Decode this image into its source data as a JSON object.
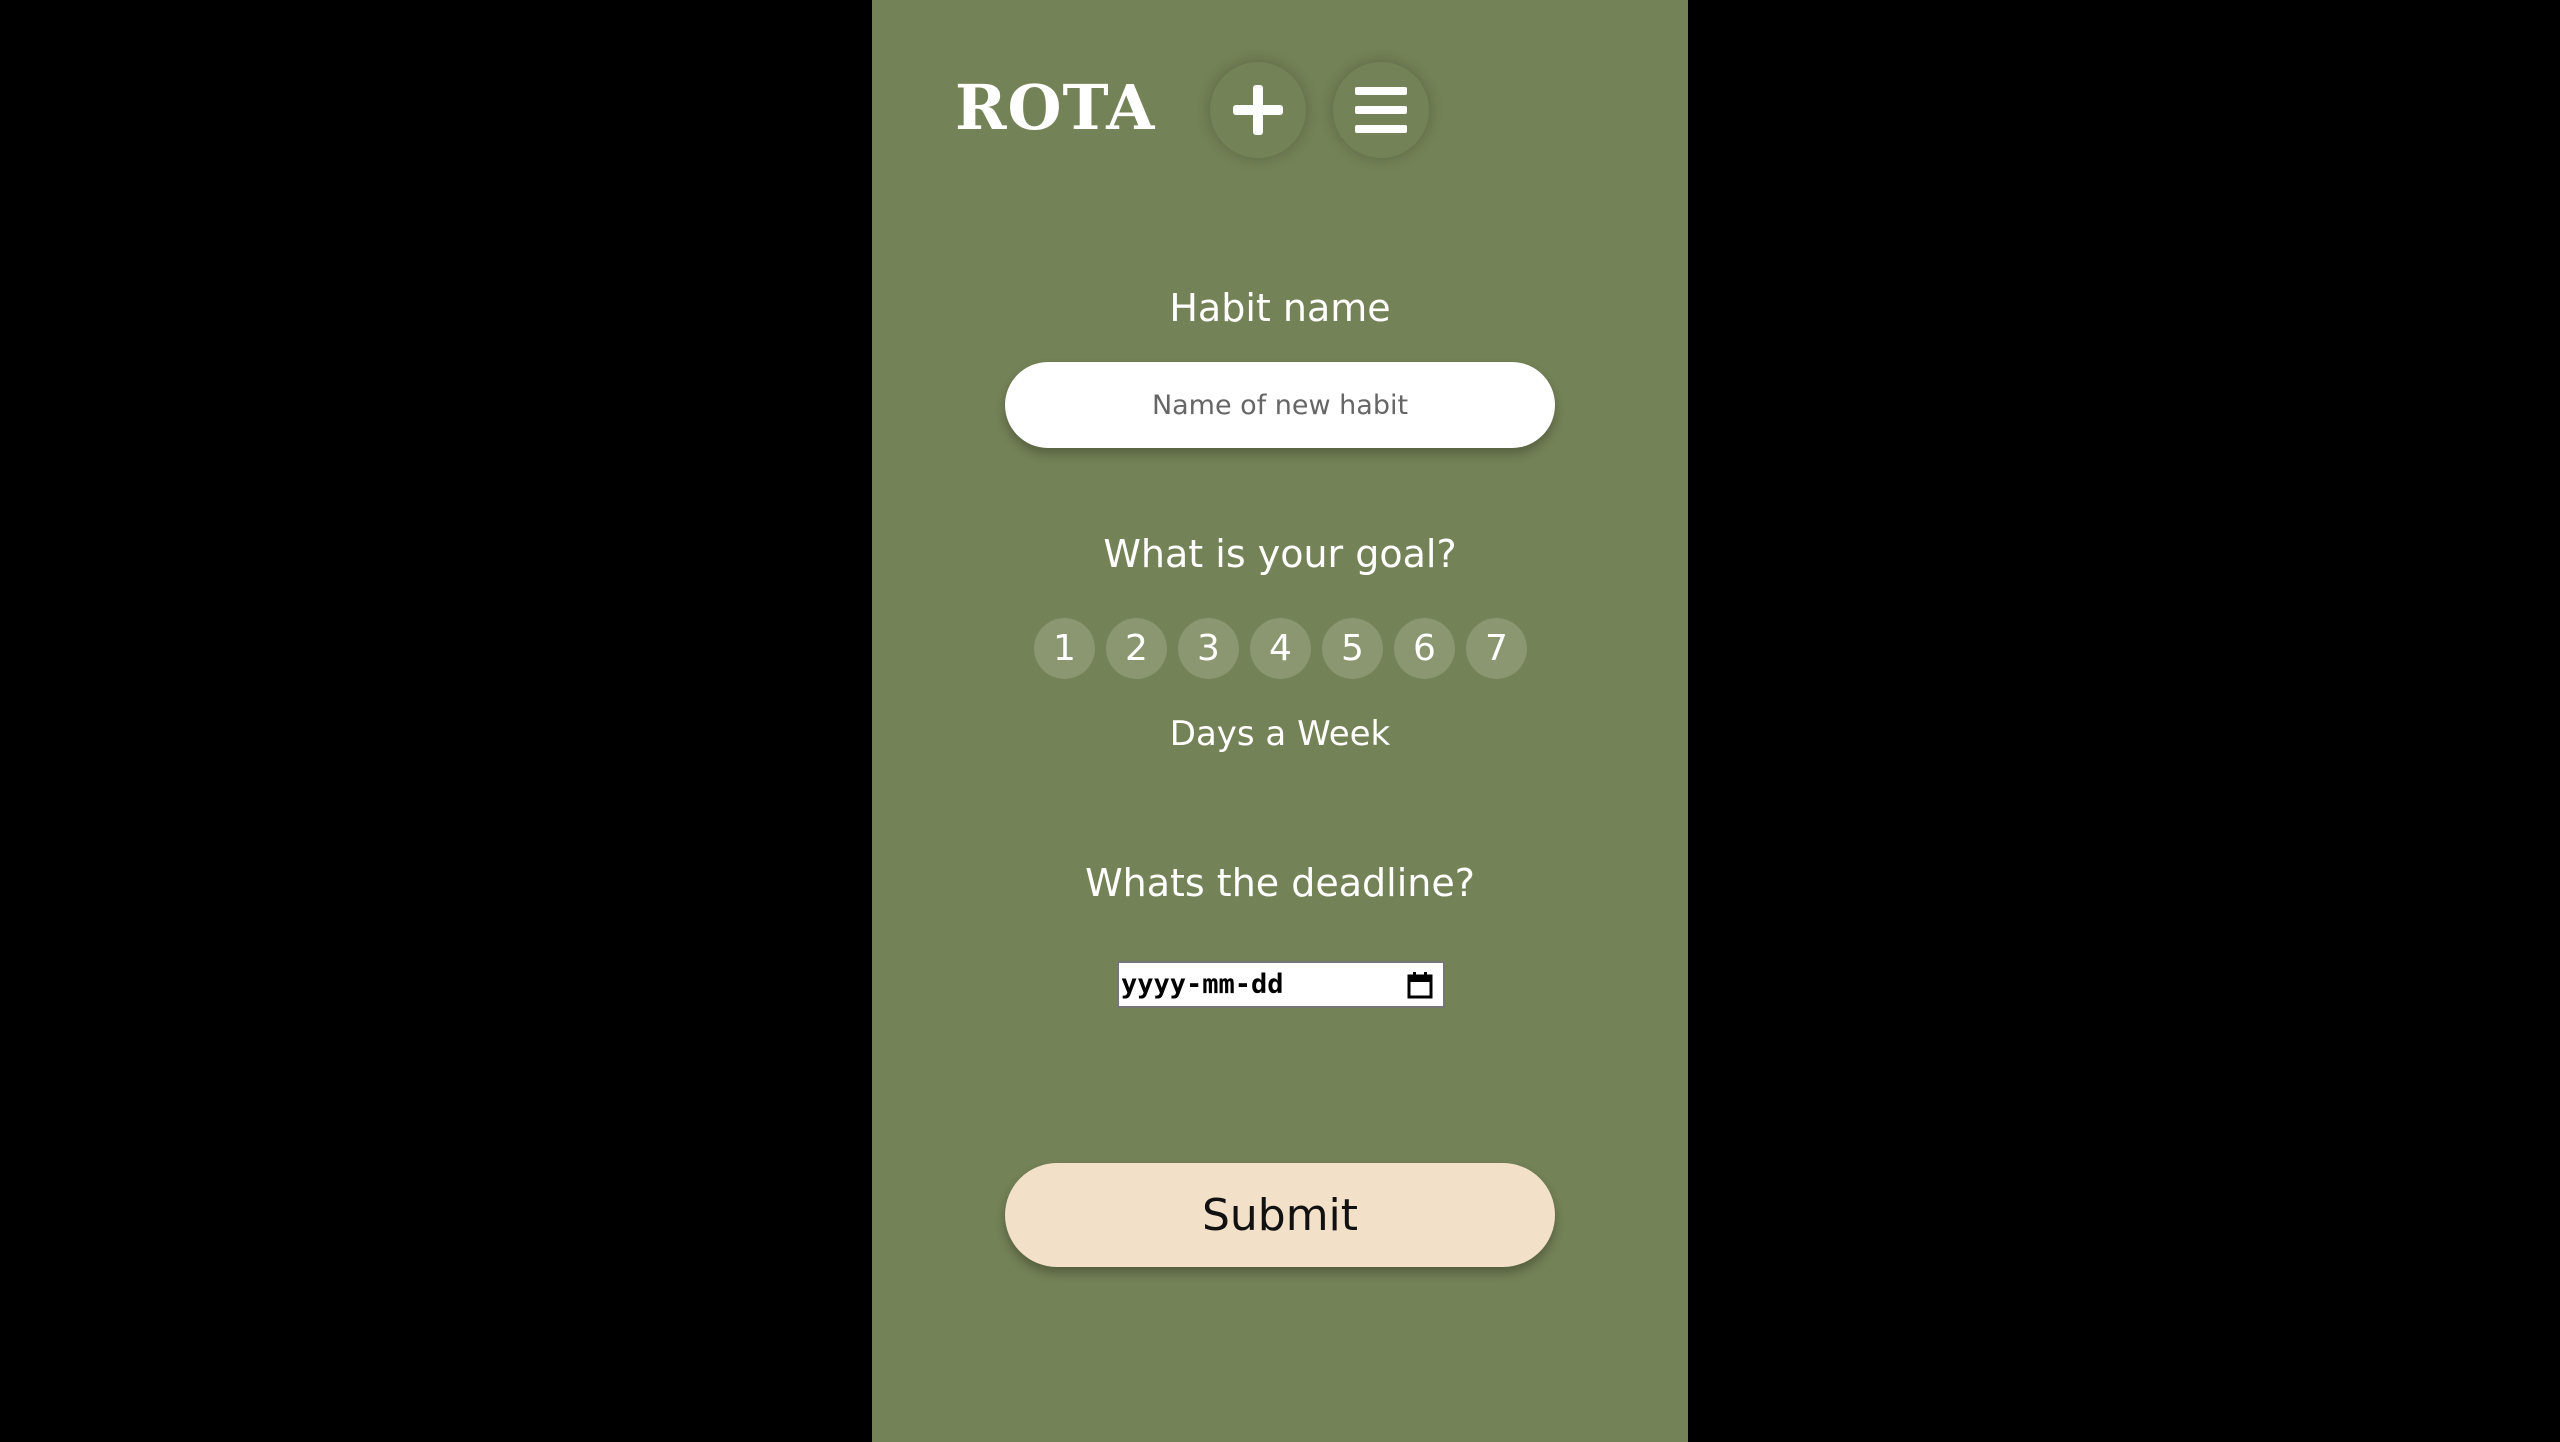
{
  "header": {
    "logo": "ROTA",
    "add_icon": "plus-icon",
    "menu_icon": "hamburger-menu-icon"
  },
  "form": {
    "habit_name_label": "Habit name",
    "habit_name_placeholder": "Name of new habit",
    "habit_name_value": "",
    "goal_label": "What is your goal?",
    "goal_options": [
      "1",
      "2",
      "3",
      "4",
      "5",
      "6",
      "7"
    ],
    "goal_unit": "Days a Week",
    "deadline_label": "Whats the deadline?",
    "deadline_placeholder": "yyyy-mm-dd",
    "deadline_icon": "calendar-icon",
    "submit_label": "Submit"
  },
  "colors": {
    "background": "#748257",
    "page_outside": "#000000",
    "day_button": "#8a9770",
    "submit_button": "#f2e0c9",
    "text": "#ffffff"
  }
}
